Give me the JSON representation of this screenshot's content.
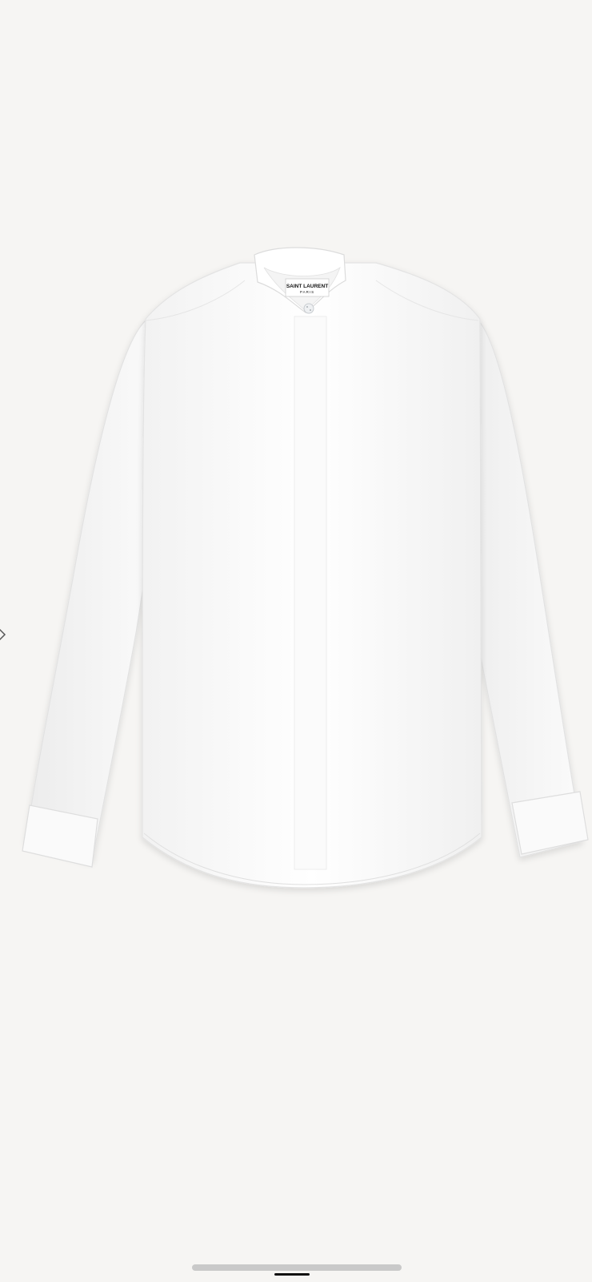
{
  "product": {
    "image_alt": "White band-collar shirt",
    "label_brand": "SAINT LAURENT",
    "label_city": "PARIS",
    "color": "#ffffff"
  },
  "gallery": {
    "prev_icon": "chevron-left-icon"
  },
  "colors": {
    "background": "#f6f5f3",
    "scrollbar": "#c9c9c9",
    "home_indicator": "#111111"
  }
}
